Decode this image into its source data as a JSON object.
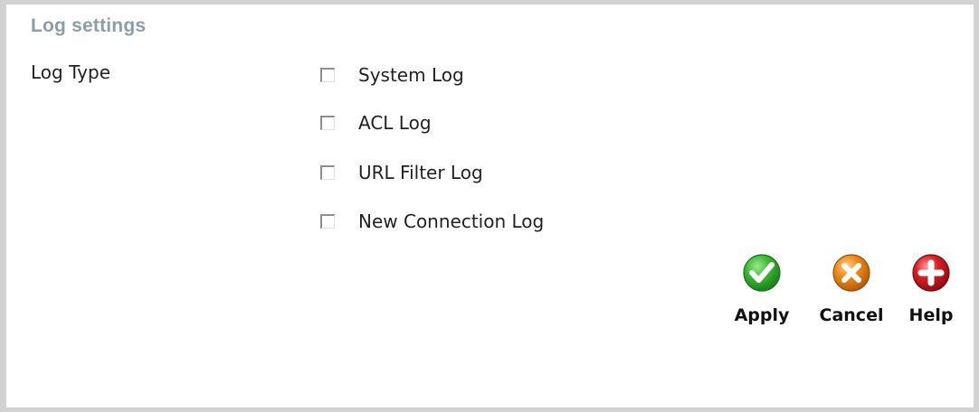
{
  "section": {
    "title": "Log settings"
  },
  "log_type": {
    "label": "Log Type",
    "options": [
      {
        "label": "System Log",
        "checked": false
      },
      {
        "label": "ACL Log",
        "checked": false
      },
      {
        "label": "URL Filter Log",
        "checked": false
      },
      {
        "label": "New Connection Log",
        "checked": false
      }
    ]
  },
  "actions": {
    "apply": {
      "label": "Apply",
      "icon": "check-icon",
      "color": "#2fae2a"
    },
    "cancel": {
      "label": "Cancel",
      "icon": "x-icon",
      "color": "#f08a1c"
    },
    "help": {
      "label": "Help",
      "icon": "plus-icon",
      "color": "#d81f26"
    }
  }
}
